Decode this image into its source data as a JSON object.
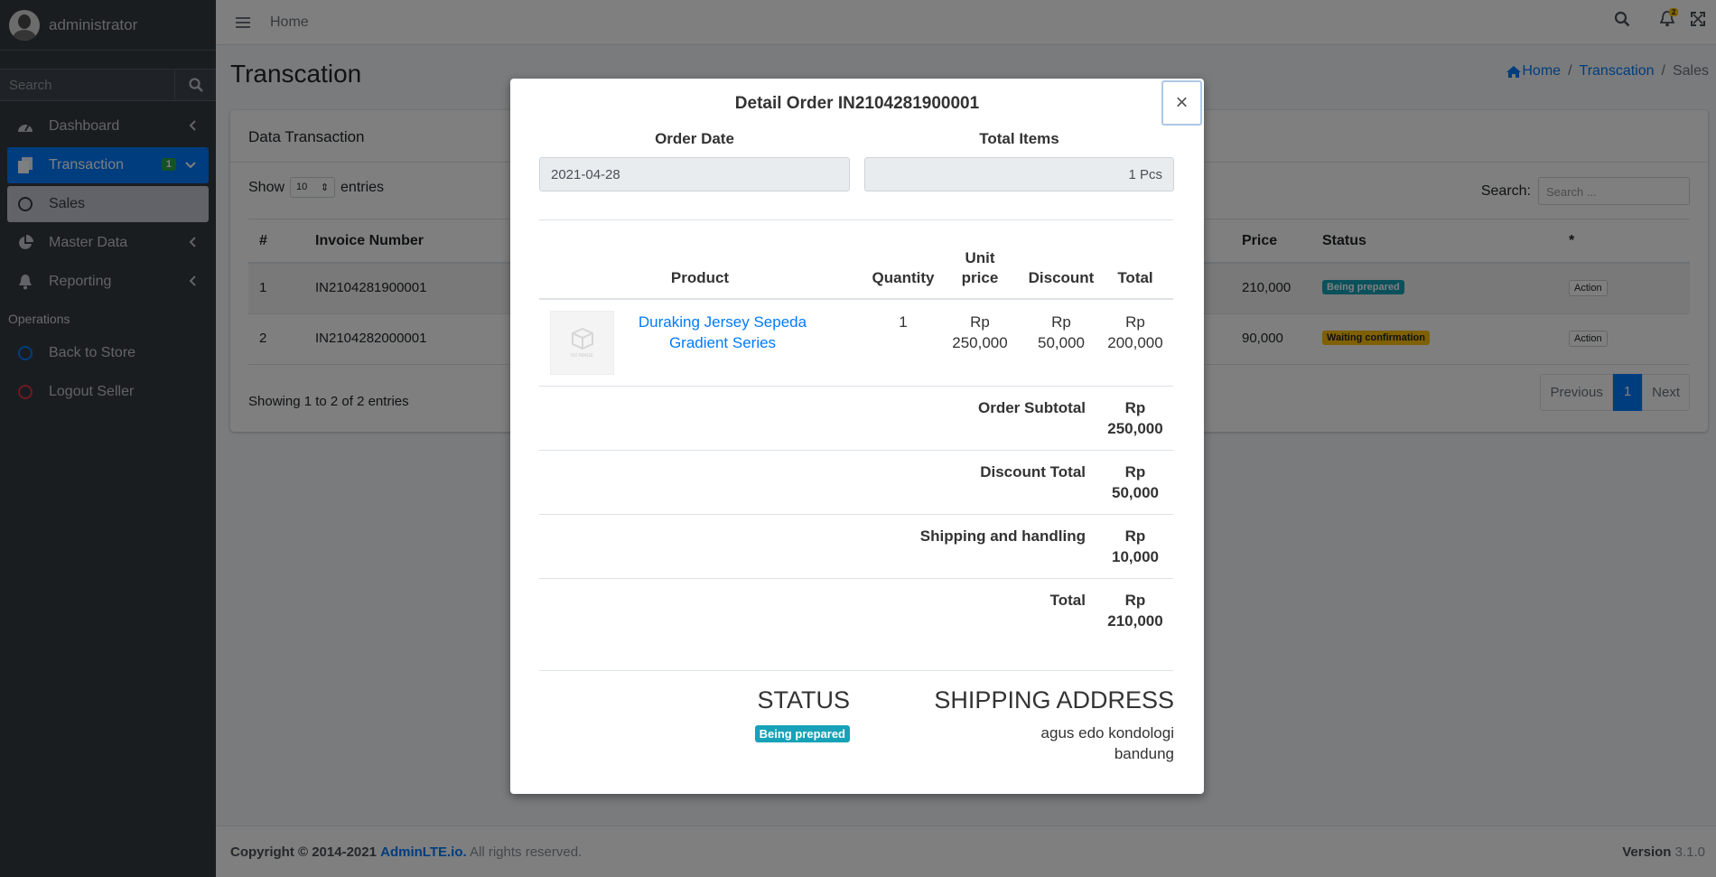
{
  "sidebar": {
    "username": "administrator",
    "search_placeholder": "Search",
    "items": [
      {
        "label": "Dashboard"
      },
      {
        "label": "Transaction",
        "badge": "1"
      },
      {
        "label": "Sales"
      },
      {
        "label": "Master Data"
      },
      {
        "label": "Reporting"
      }
    ],
    "section_header": "Operations",
    "ops": [
      {
        "label": "Back to Store"
      },
      {
        "label": "Logout Seller"
      }
    ]
  },
  "topbar": {
    "home": "Home",
    "notif_count": "2"
  },
  "page": {
    "title": "Transcation",
    "breadcrumb": {
      "home": "Home",
      "mid": "Transcation",
      "current": "Sales"
    }
  },
  "card": {
    "title": "Data Transaction",
    "show_label": "Show",
    "entries_value": "10",
    "entries_label": "entries",
    "search_label": "Search:",
    "search_placeholder": "Search ...",
    "columns": {
      "num": "#",
      "invoice": "Invoice Number",
      "price": "Price",
      "status": "Status",
      "star": "*"
    },
    "rows": [
      {
        "num": "1",
        "invoice": "IN2104281900001",
        "price": "210,000",
        "status": "Being prepared",
        "action": "Action"
      },
      {
        "num": "2",
        "invoice": "IN2104282000001",
        "price": "90,000",
        "status": "Waiting confirmation",
        "action": "Action"
      }
    ],
    "info": "Showing 1 to 2 of 2 entries",
    "pagination": {
      "prev": "Previous",
      "page": "1",
      "next": "Next"
    }
  },
  "footer": {
    "copyright": "Copyright © 2014-2021",
    "brand": "AdminLTE.io.",
    "rights": "All rights reserved.",
    "version_label": "Version",
    "version": "3.1.0"
  },
  "modal": {
    "title": "Detail Order IN2104281900001",
    "close": "×",
    "order_date_label": "Order Date",
    "order_date": "2021-04-28",
    "total_items_label": "Total Items",
    "total_items": "1 Pcs",
    "headers": {
      "product": "Product",
      "quantity": "Quantity",
      "unit_price_1": "Unit",
      "unit_price_2": "price",
      "discount": "Discount",
      "total": "Total"
    },
    "item": {
      "image_text": "NO IMAGE",
      "name_1": "Duraking Jersey Sepeda",
      "name_2": "Gradient Series",
      "quantity": "1",
      "unit_price_1": "Rp",
      "unit_price_2": "250,000",
      "discount_1": "Rp",
      "discount_2": "50,000",
      "total_1": "Rp",
      "total_2": "200,000"
    },
    "summary": [
      {
        "label": "Order Subtotal",
        "cur": "Rp",
        "amount": "250,000"
      },
      {
        "label": "Discount Total",
        "cur": "Rp",
        "amount": "50,000"
      },
      {
        "label": "Shipping and handling",
        "cur": "Rp",
        "amount": "10,000"
      },
      {
        "label": "Total",
        "cur": "Rp",
        "amount": "210,000"
      }
    ],
    "status_heading": "STATUS",
    "status": "Being prepared",
    "shipping_heading": "SHIPPING ADDRESS",
    "address_1": "agus edo kondologi",
    "address_2": "bandung"
  }
}
